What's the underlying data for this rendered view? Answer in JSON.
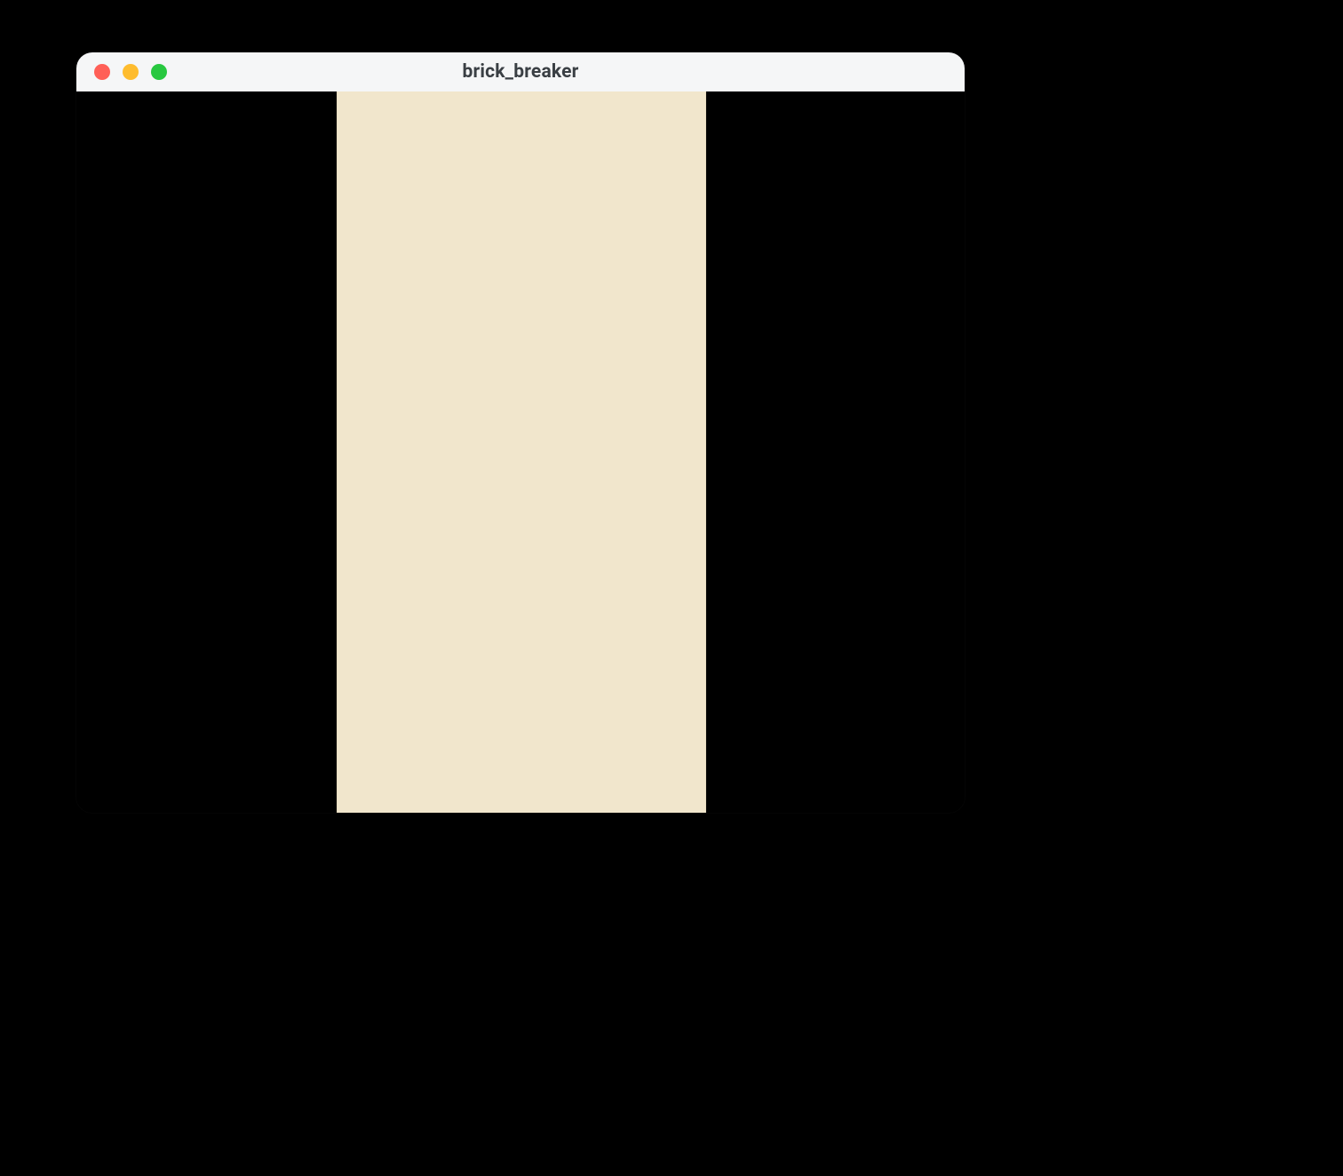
{
  "window": {
    "title": "brick_breaker"
  },
  "traffic_lights": {
    "close": "close-icon",
    "minimize": "minimize-icon",
    "maximize": "maximize-icon"
  },
  "colors": {
    "page_bg": "#000000",
    "titlebar_bg": "#f5f6f7",
    "title_text": "#3a3f44",
    "content_bg": "#000000",
    "canvas_bg": "#f1e6cc",
    "traffic_close": "#ff5f57",
    "traffic_min": "#febc2e",
    "traffic_max": "#28c840"
  }
}
